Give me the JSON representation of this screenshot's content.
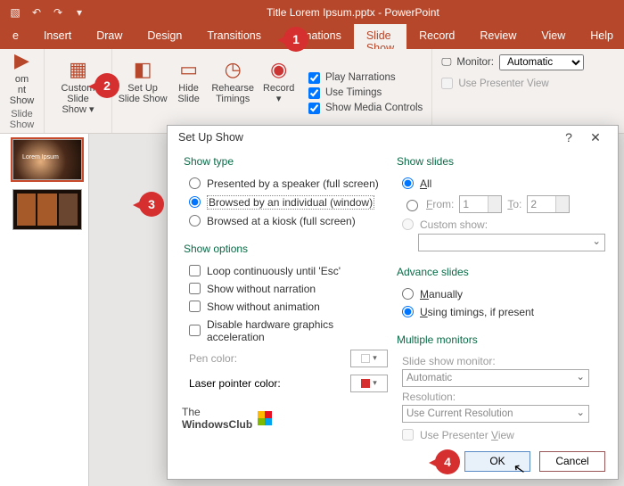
{
  "title": "Title Lorem Ipsum.pptx - PowerPoint",
  "tabs": [
    "e",
    "Insert",
    "Draw",
    "Design",
    "Transitions",
    "Animations",
    "Slide Show",
    "Record",
    "Review",
    "View",
    "Help"
  ],
  "active_tab": 6,
  "ribbon": {
    "group_a": {
      "btns": [
        {
          "l1": "om",
          "l2": "nt Show"
        }
      ],
      "label": "Slide Show"
    },
    "group_b": {
      "btns": [
        {
          "l1": "Custom Slide",
          "l2": "Show ▾"
        }
      ],
      "label": ""
    },
    "group_c": {
      "btns": [
        {
          "l1": "Set Up",
          "l2": "Slide Show"
        },
        {
          "l1": "Hide",
          "l2": "Slide"
        },
        {
          "l1": "Rehearse",
          "l2": "Timings"
        },
        {
          "l1": "Record",
          "l2": "▾"
        }
      ],
      "label": ""
    },
    "checks": [
      "Play Narrations",
      "Use Timings",
      "Show Media Controls"
    ],
    "monitor_label": "Monitor:",
    "monitor_value": "Automatic",
    "presenter_view": "Use Presenter View"
  },
  "thumbs": {
    "t1": "Lorem Ipsum"
  },
  "dialog": {
    "title": "Set Up Show",
    "show_type": {
      "head": "Show type",
      "opts": [
        "Presented by a speaker (full screen)",
        "Browsed by an individual (window)",
        "Browsed at a kiosk (full screen)"
      ],
      "sel": 1
    },
    "show_options": {
      "head": "Show options",
      "opts": [
        "Loop continuously until 'Esc'",
        "Show without narration",
        "Show without animation",
        "Disable hardware graphics acceleration"
      ],
      "pen": "Pen color:",
      "laser": "Laser pointer color:"
    },
    "show_slides": {
      "head": "Show slides",
      "all": "All",
      "from": "From:",
      "to": "To:",
      "from_v": "1",
      "to_v": "2",
      "custom": "Custom show:"
    },
    "advance": {
      "head": "Advance slides",
      "opts": [
        "Manually",
        "Using timings, if present"
      ],
      "sel": 1
    },
    "monitors": {
      "head": "Multiple monitors",
      "mon_lbl": "Slide show monitor:",
      "mon_val": "Automatic",
      "res_lbl": "Resolution:",
      "res_val": "Use Current Resolution",
      "pv": "Use Presenter View"
    },
    "ok": "OK",
    "cancel": "Cancel"
  },
  "wm": {
    "l1": "The",
    "l2": "WindowsClub"
  },
  "callouts": [
    "1",
    "2",
    "3",
    "4"
  ]
}
